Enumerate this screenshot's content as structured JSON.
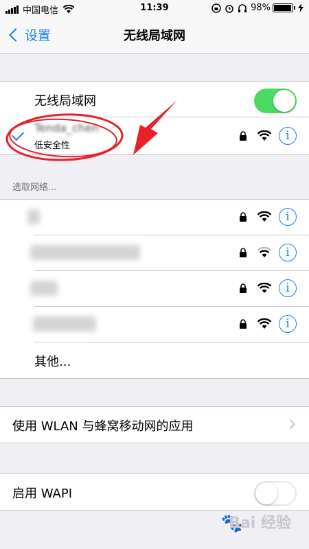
{
  "status_bar": {
    "carrier": "中国电信",
    "time": "11:39",
    "battery_text": "98%",
    "battery_level": 0.98
  },
  "nav": {
    "back_label": "设置",
    "title": "无线局域网"
  },
  "wifi_group": {
    "toggle_label": "无线局域网",
    "toggle_on": true,
    "connected": {
      "name": "Tenda_chen",
      "security_note": "低安全性"
    }
  },
  "choose_network": {
    "header": "选取网络...",
    "other_label": "其他..."
  },
  "wlan_apps": {
    "label": "使用 WLAN 与蜂窝移动网的应用"
  },
  "wapi": {
    "label": "启用 WAPI",
    "toggle_on": false
  },
  "icons": {
    "info": "ⓘ",
    "info_glyph": "i"
  },
  "colors": {
    "accent": "#157efb",
    "toggle_on": "#4cd964",
    "annotation": "#e8202a"
  },
  "watermark": {
    "text": "Bai 经验"
  }
}
